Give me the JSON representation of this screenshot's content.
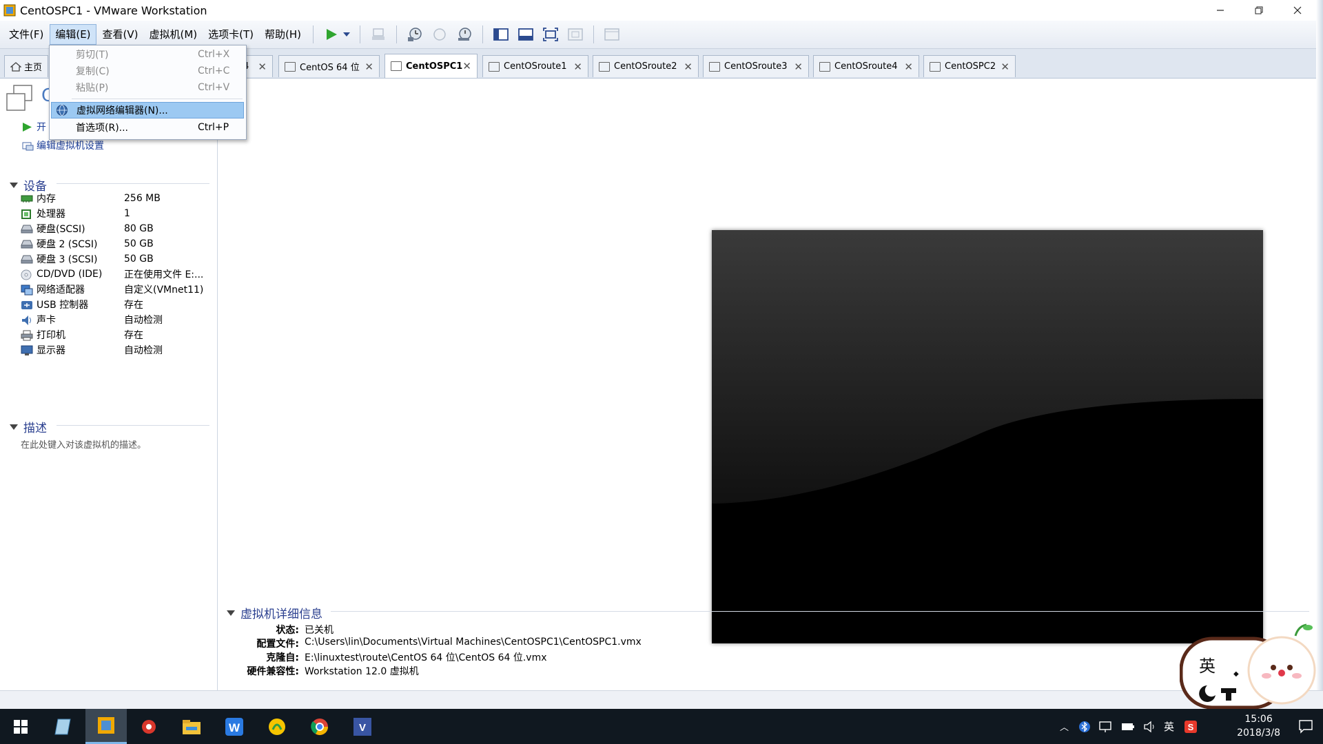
{
  "window": {
    "title": "CentOSPC1 - VMware Workstation"
  },
  "menubar": {
    "items": [
      "文件(F)",
      "编辑(E)",
      "查看(V)",
      "虚拟机(M)",
      "选项卡(T)",
      "帮助(H)"
    ]
  },
  "tabs": [
    {
      "label": "主页"
    },
    {
      "label": "4"
    },
    {
      "label": "CentOS 64 位"
    },
    {
      "label": "CentOSPC1"
    },
    {
      "label": "CentOSroute1"
    },
    {
      "label": "CentOSroute2"
    },
    {
      "label": "CentOSroute3"
    },
    {
      "label": "CentOSroute4"
    },
    {
      "label": "CentOSPC2"
    }
  ],
  "edit_menu": {
    "items": [
      {
        "label": "剪切(T)",
        "shortcut": "Ctrl+X",
        "disabled": true
      },
      {
        "label": "复制(C)",
        "shortcut": "Ctrl+C",
        "disabled": true
      },
      {
        "label": "粘贴(P)",
        "shortcut": "Ctrl+V",
        "disabled": true
      },
      {
        "label": "虚拟网络编辑器(N)...",
        "shortcut": "",
        "highlighted": true
      },
      {
        "label": "首选项(R)...",
        "shortcut": "Ctrl+P"
      }
    ]
  },
  "vm": {
    "name_partial": "C",
    "actions": {
      "power_on_partial": "开",
      "edit_settings": "编辑虚拟机设置"
    }
  },
  "devices": {
    "header": "设备",
    "rows": [
      {
        "name": "内存",
        "value": "256 MB",
        "icon": "memory-icon"
      },
      {
        "name": "处理器",
        "value": "1",
        "icon": "cpu-icon"
      },
      {
        "name": "硬盘(SCSI)",
        "value": "80 GB",
        "icon": "hard-disk-icon"
      },
      {
        "name": "硬盘 2 (SCSI)",
        "value": "50 GB",
        "icon": "hard-disk-icon"
      },
      {
        "name": "硬盘 3 (SCSI)",
        "value": "50 GB",
        "icon": "hard-disk-icon"
      },
      {
        "name": "CD/DVD (IDE)",
        "value": "正在使用文件 E:...",
        "icon": "cd-dvd-icon"
      },
      {
        "name": "网络适配器",
        "value": "自定义(VMnet11)",
        "icon": "network-adapter-icon"
      },
      {
        "name": "USB 控制器",
        "value": "存在",
        "icon": "usb-icon"
      },
      {
        "name": "声卡",
        "value": "自动检测",
        "icon": "sound-card-icon"
      },
      {
        "name": "打印机",
        "value": "存在",
        "icon": "printer-icon"
      },
      {
        "name": "显示器",
        "value": "自动检测",
        "icon": "display-icon"
      }
    ]
  },
  "description": {
    "header": "描述",
    "placeholder": "在此处键入对该虚拟机的描述。"
  },
  "details": {
    "header": "虚拟机详细信息",
    "rows": [
      {
        "label": "状态:",
        "value": "已关机"
      },
      {
        "label": "配置文件:",
        "value": "C:\\Users\\lin\\Documents\\Virtual Machines\\CentOSPC1\\CentOSPC1.vmx"
      },
      {
        "label": "克隆自:",
        "value": "E:\\linuxtest\\route\\CentOS 64 位\\CentOS 64 位.vmx"
      },
      {
        "label": "硬件兼容性:",
        "value": "Workstation 12.0 虚拟机"
      }
    ]
  },
  "taskbar": {
    "tray": {
      "ime": "英",
      "time": "15:06",
      "date": "2018/3/8"
    }
  },
  "sticker": {
    "text": "英"
  },
  "colors": {
    "accent": "#2a3f8f",
    "menu_highlight": "#9cc9f2",
    "taskbar": "#101820"
  }
}
